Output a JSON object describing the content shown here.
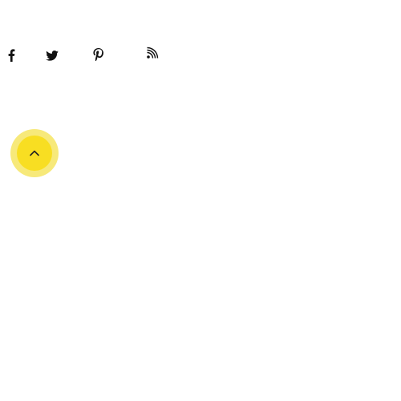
{
  "social": {
    "items": [
      {
        "id": "facebook",
        "icon": "facebook-icon"
      },
      {
        "id": "twitter",
        "icon": "twitter-icon"
      },
      {
        "id": "pinterest",
        "icon": "pinterest-icon"
      },
      {
        "id": "rss",
        "icon": "rss-icon"
      }
    ],
    "icon_color": "#111111"
  },
  "back_to_top": {
    "icon": "chevron-up-icon",
    "outer_color": "#f7e97a",
    "inner_color": "#f8de22",
    "icon_color": "#222222"
  }
}
